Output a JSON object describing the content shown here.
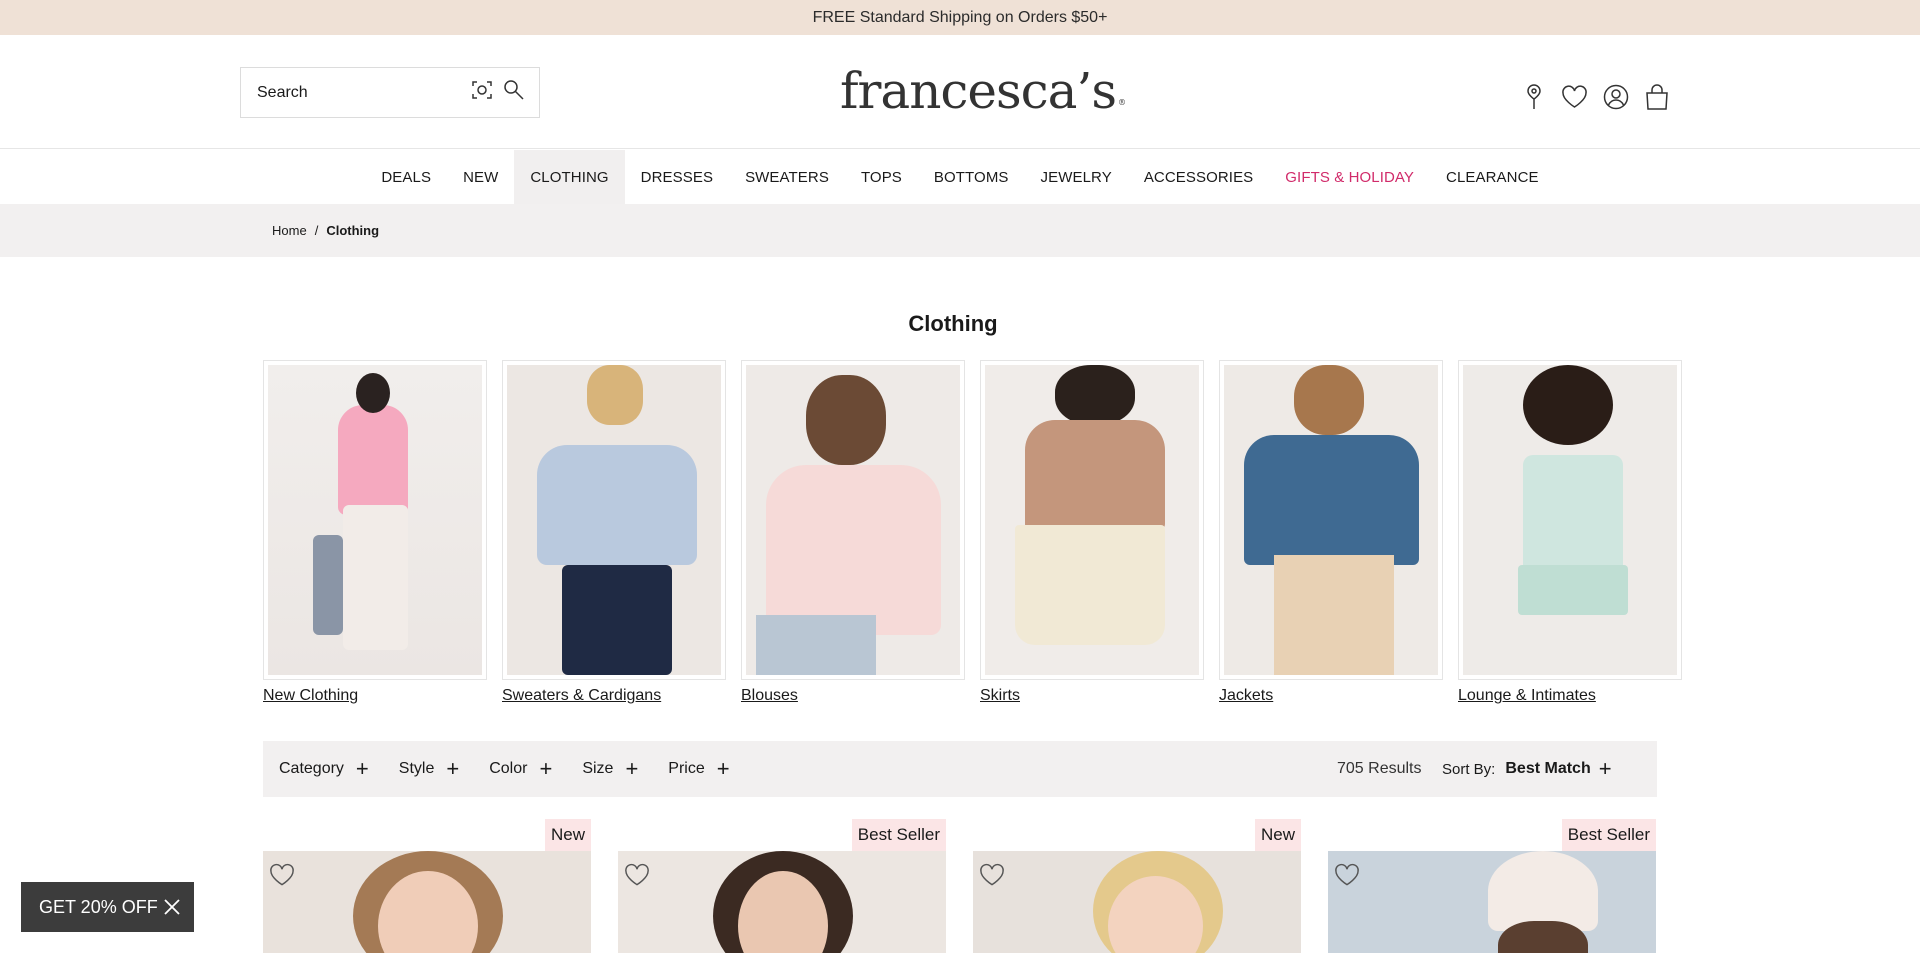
{
  "promo": {
    "text": "FREE Standard Shipping on Orders $50+"
  },
  "header": {
    "search_placeholder": "Search",
    "logo_text": "francesca’s",
    "icons": [
      "location-pin-icon",
      "heart-icon",
      "user-account-icon",
      "shopping-bag-icon"
    ]
  },
  "nav": {
    "items": [
      {
        "label": "DEALS"
      },
      {
        "label": "NEW"
      },
      {
        "label": "CLOTHING"
      },
      {
        "label": "DRESSES"
      },
      {
        "label": "SWEATERS"
      },
      {
        "label": "TOPS"
      },
      {
        "label": "BOTTOMS"
      },
      {
        "label": "JEWELRY"
      },
      {
        "label": "ACCESSORIES"
      },
      {
        "label": "GIFTS & HOLIDAY"
      },
      {
        "label": "CLEARANCE"
      }
    ],
    "active": "CLOTHING",
    "holiday_color": "#d12b6a"
  },
  "breadcrumb": {
    "home": "Home",
    "separator": "/",
    "current": "Clothing"
  },
  "page": {
    "title": "Clothing"
  },
  "categories": [
    {
      "label": "New Clothing"
    },
    {
      "label": "Sweaters & Cardigans"
    },
    {
      "label": "Blouses"
    },
    {
      "label": "Skirts"
    },
    {
      "label": "Jackets"
    },
    {
      "label": "Lounge & Intimates"
    }
  ],
  "filters": {
    "items": [
      {
        "label": "Category"
      },
      {
        "label": "Style"
      },
      {
        "label": "Color"
      },
      {
        "label": "Size"
      },
      {
        "label": "Price"
      }
    ],
    "plus": "+",
    "results": "705 Results",
    "sort_label": "Sort By:",
    "sort_value": "Best Match"
  },
  "products": [
    {
      "badge": "New"
    },
    {
      "badge": "Best Seller"
    },
    {
      "badge": "New"
    },
    {
      "badge": "Best Seller"
    }
  ],
  "discount": {
    "label": "GET 20% OFF"
  },
  "colors": {
    "promo_bg": "#efe1d6",
    "breadcrumb_bg": "#f2f0f0",
    "badge_bg": "#fbe5e6",
    "pill_bg": "#3c3c3c"
  }
}
